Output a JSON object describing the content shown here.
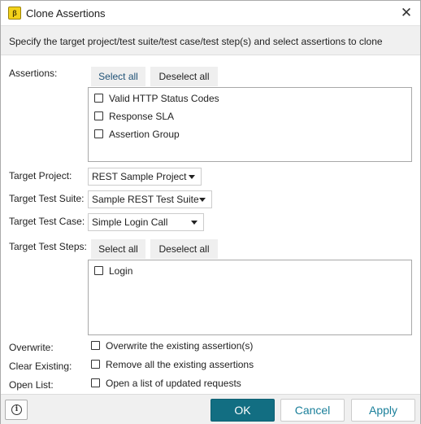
{
  "window": {
    "title": "Clone Assertions",
    "close_glyph": "✕",
    "app_icon_glyph": "β"
  },
  "description": "Specify the target project/test suite/test case/test step(s) and select assertions to clone",
  "assertions": {
    "label": "Assertions:",
    "select_all": "Select all",
    "deselect_all": "Deselect all",
    "items": [
      {
        "label": "Valid HTTP Status Codes",
        "checked": false
      },
      {
        "label": "Response SLA",
        "checked": false
      },
      {
        "label": "Assertion Group",
        "checked": false
      }
    ]
  },
  "target_project": {
    "label": "Target Project:",
    "value": "REST Sample Project"
  },
  "target_test_suite": {
    "label": "Target Test Suite:",
    "value": "Sample REST Test Suite"
  },
  "target_test_case": {
    "label": "Target Test Case:",
    "value": "Simple Login Call"
  },
  "target_test_steps": {
    "label": "Target Test Steps:",
    "select_all": "Select all",
    "deselect_all": "Deselect all",
    "items": [
      {
        "label": "Login",
        "checked": false
      }
    ]
  },
  "options": {
    "overwrite": {
      "label": "Overwrite:",
      "text": "Overwrite the existing assertion(s)",
      "checked": false
    },
    "clear_existing": {
      "label": "Clear Existing:",
      "text": "Remove all the existing assertions",
      "checked": false
    },
    "open_list": {
      "label": "Open List:",
      "text": "Open a list of updated requests",
      "checked": false
    }
  },
  "footer": {
    "info_glyph": "i",
    "ok": "OK",
    "cancel": "Cancel",
    "apply": "Apply"
  },
  "colors": {
    "primary": "#126e82",
    "link": "#1a7f9a",
    "select_all_text": "#1f5176"
  },
  "icons": {
    "app": "soapui-logo-icon",
    "close": "close-icon",
    "info": "info-icon",
    "dropdown": "chevron-down-icon",
    "checkbox": "checkbox-icon"
  }
}
